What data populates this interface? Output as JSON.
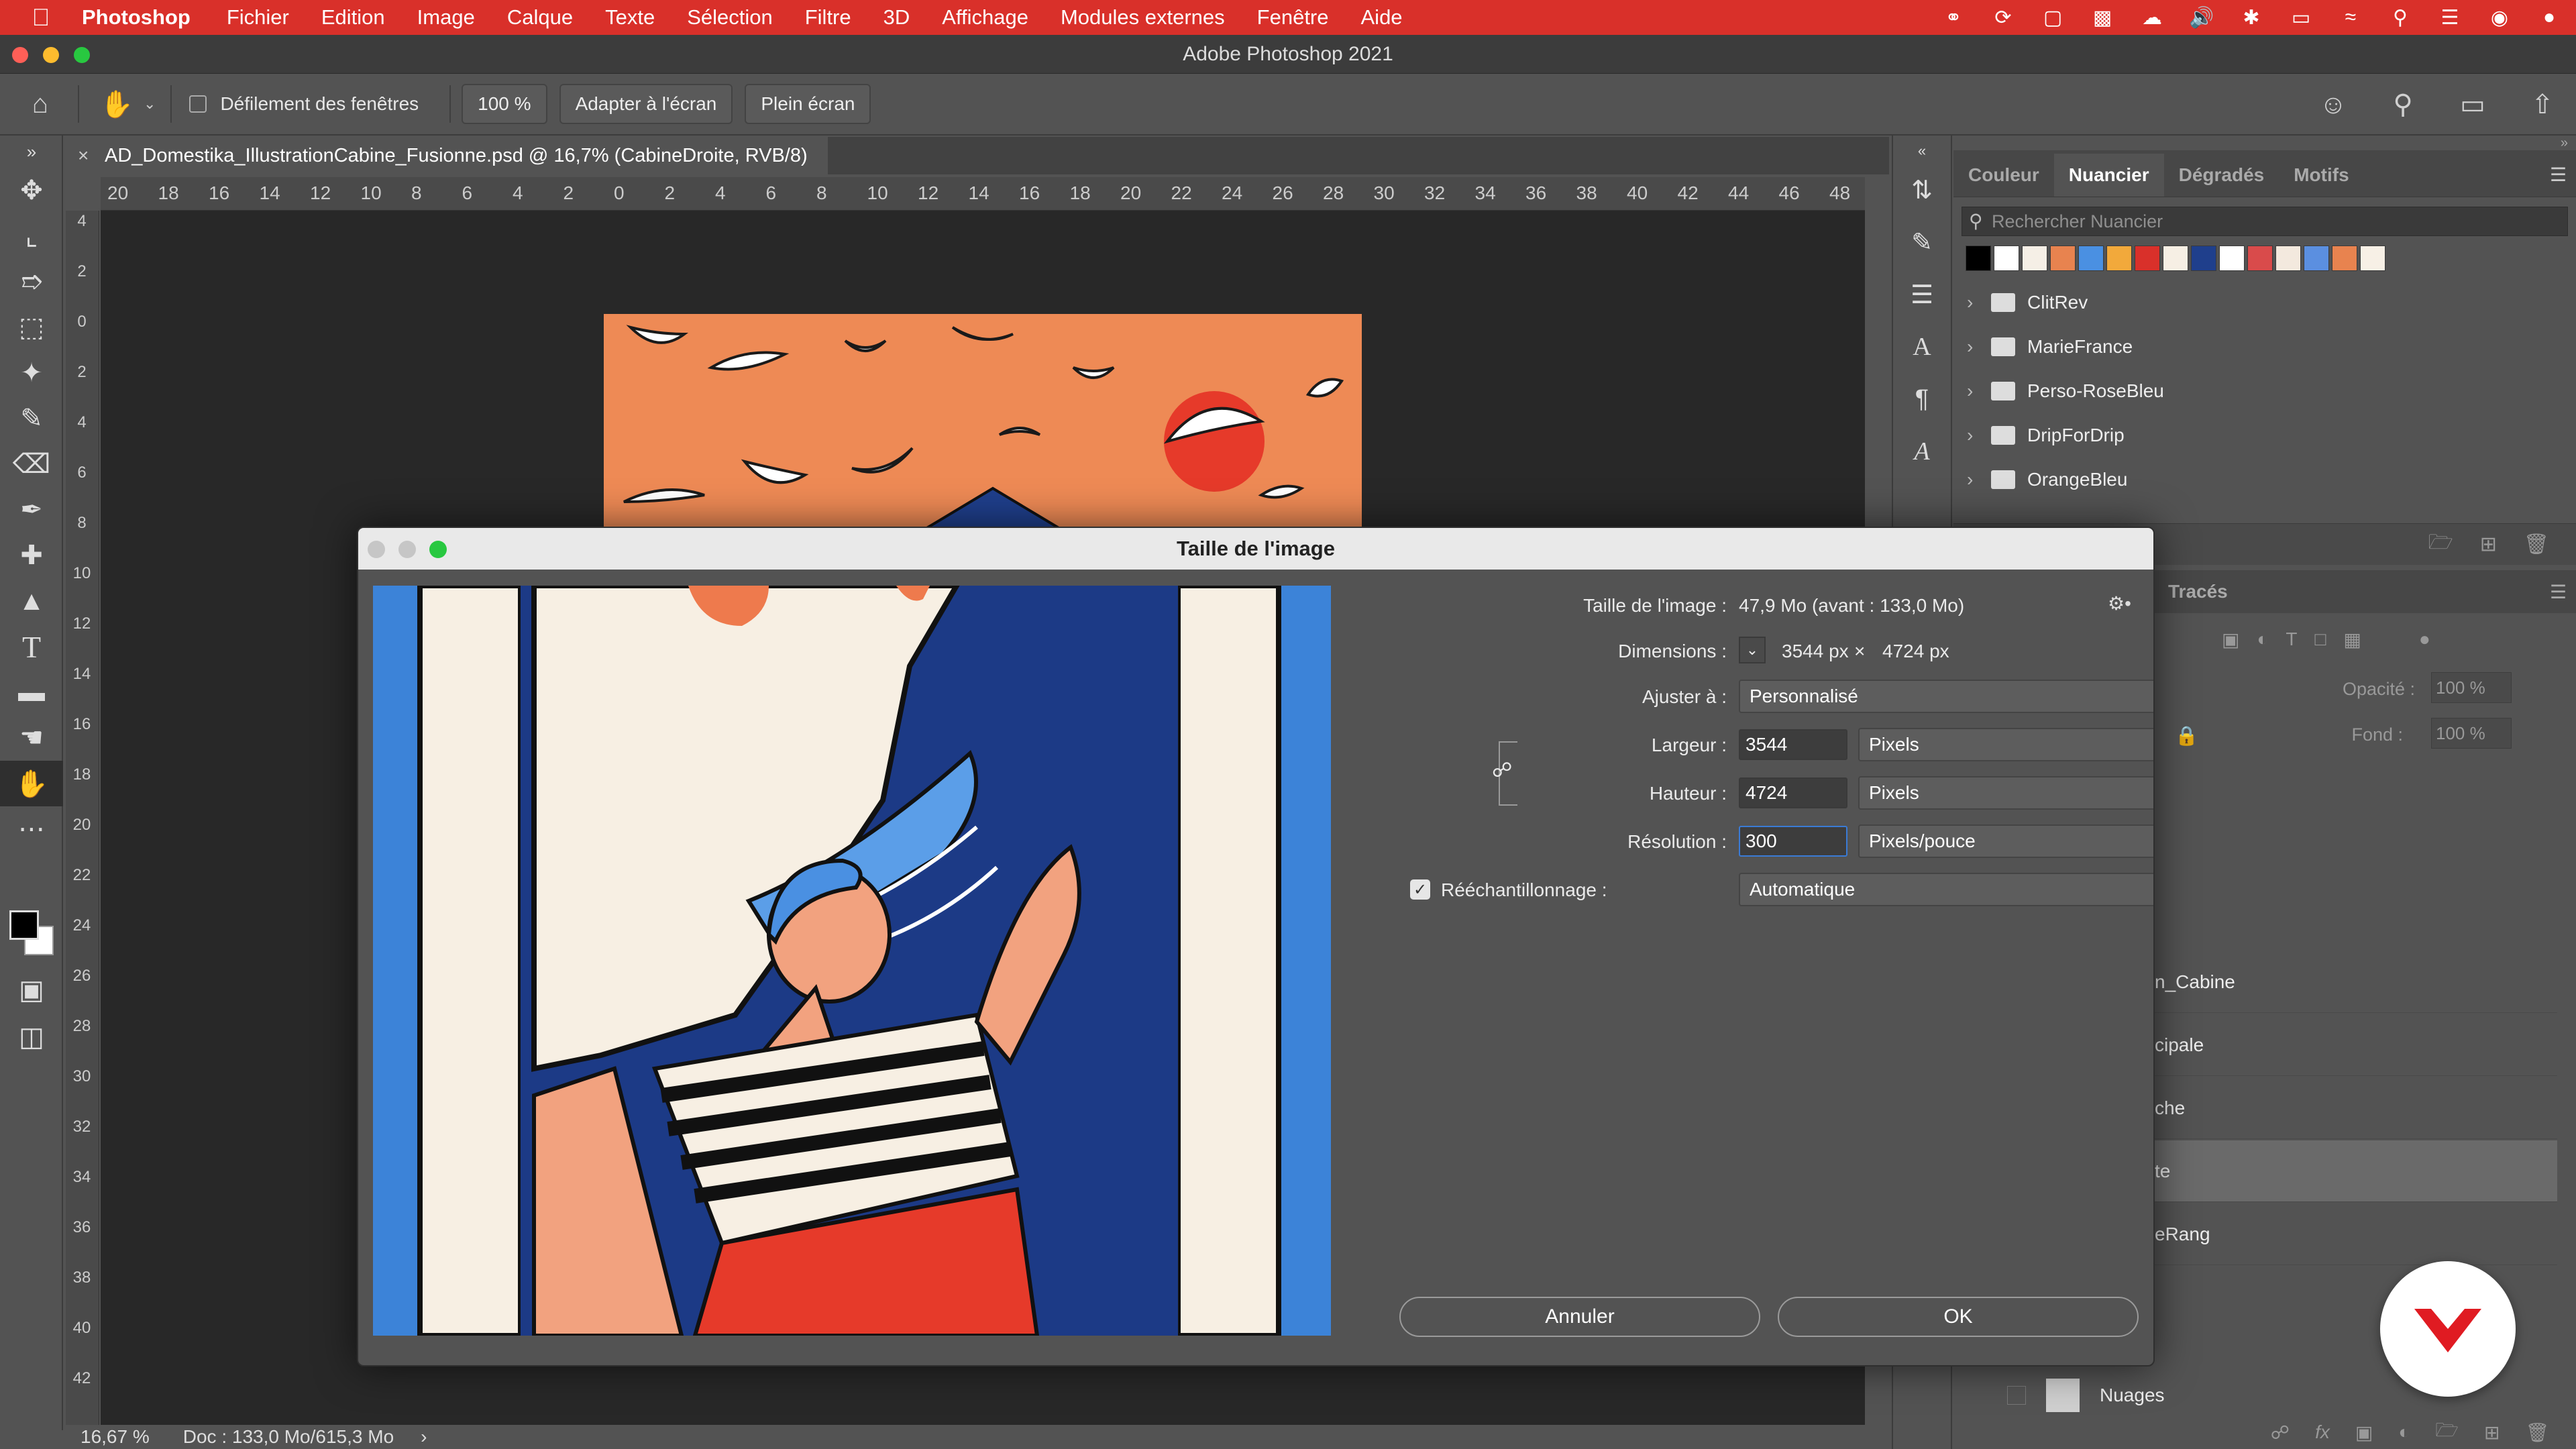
{
  "menubar": {
    "app_name": "Photoshop",
    "items": [
      "Fichier",
      "Edition",
      "Image",
      "Calque",
      "Texte",
      "Sélection",
      "Filtre",
      "3D",
      "Affichage",
      "Modules externes",
      "Fenêtre",
      "Aide"
    ]
  },
  "window": {
    "title": "Adobe Photoshop 2021"
  },
  "options_bar": {
    "scroll_all_windows_label": "Défilement des fenêtres",
    "zoom_value": "100 %",
    "fit_screen_label": "Adapter à l'écran",
    "full_screen_label": "Plein écran"
  },
  "document": {
    "tab_title": "AD_Domestika_IllustrationCabine_Fusionne.psd @ 16,7% (CabineDroite, RVB/8)"
  },
  "rulers": {
    "horizontal": [
      "20",
      "18",
      "16",
      "14",
      "12",
      "10",
      "8",
      "6",
      "4",
      "2",
      "0",
      "2",
      "4",
      "6",
      "8",
      "10",
      "12",
      "14",
      "16",
      "18",
      "20",
      "22",
      "24",
      "26",
      "28",
      "30",
      "32",
      "34",
      "36",
      "38",
      "40",
      "42",
      "44",
      "46",
      "48"
    ],
    "vertical": [
      "4",
      "2",
      "0",
      "2",
      "4",
      "6",
      "8",
      "10",
      "12",
      "14",
      "16",
      "18",
      "20",
      "22",
      "24",
      "26",
      "28",
      "30",
      "32",
      "34",
      "36",
      "38",
      "40",
      "42"
    ]
  },
  "status_bar": {
    "zoom": "16,67 %",
    "doc_info": "Doc : 133,0 Mo/615,3 Mo"
  },
  "swatches_panel": {
    "tabs": [
      "Couleur",
      "Nuancier",
      "Dégradés",
      "Motifs"
    ],
    "active_tab": "Nuancier",
    "search_placeholder": "Rechercher Nuancier",
    "colors": [
      "#000000",
      "#ffffff",
      "#f5efe6",
      "#e8834f",
      "#4a90e2",
      "#f2a93b",
      "#d9302a",
      "#f6efe4",
      "#1f3f8c",
      "#ffffff",
      "#d94b4b",
      "#f3e9de",
      "#5b8fe0",
      "#e8834f",
      "#f7f0e6"
    ],
    "folders": [
      "ClitRev",
      "MarieFrance",
      "Perso-RoseBleu",
      "DripForDrip",
      "OrangeBleu"
    ]
  },
  "layers_panel": {
    "visible_tab": "Tracés",
    "opacity_label": "Opacité :",
    "opacity_value": "100 %",
    "fill_label": "Fond :",
    "fill_value": "100 %",
    "partial_rows": [
      "n_Cabine",
      "cipale",
      "che",
      "te",
      "eRang"
    ],
    "layer_nuages": "Nuages"
  },
  "dialog": {
    "title": "Taille de l'image",
    "image_size_label": "Taille de l'image :",
    "image_size_value": "47,9 Mo (avant : 133,0 Mo)",
    "dimensions_label": "Dimensions :",
    "dimensions_width": "3544 px",
    "dimensions_sep": "×",
    "dimensions_height": "4724 px",
    "fit_to_label": "Ajuster à :",
    "fit_to_value": "Personnalisé",
    "width_label": "Largeur :",
    "width_value": "3544",
    "width_unit": "Pixels",
    "height_label": "Hauteur :",
    "height_value": "4724",
    "height_unit": "Pixels",
    "resolution_label": "Résolution :",
    "resolution_value": "300",
    "resolution_unit": "Pixels/pouce",
    "resample_label": "Rééchantillonnage :",
    "resample_checked": true,
    "resample_value": "Automatique",
    "cancel_label": "Annuler",
    "ok_label": "OK"
  }
}
